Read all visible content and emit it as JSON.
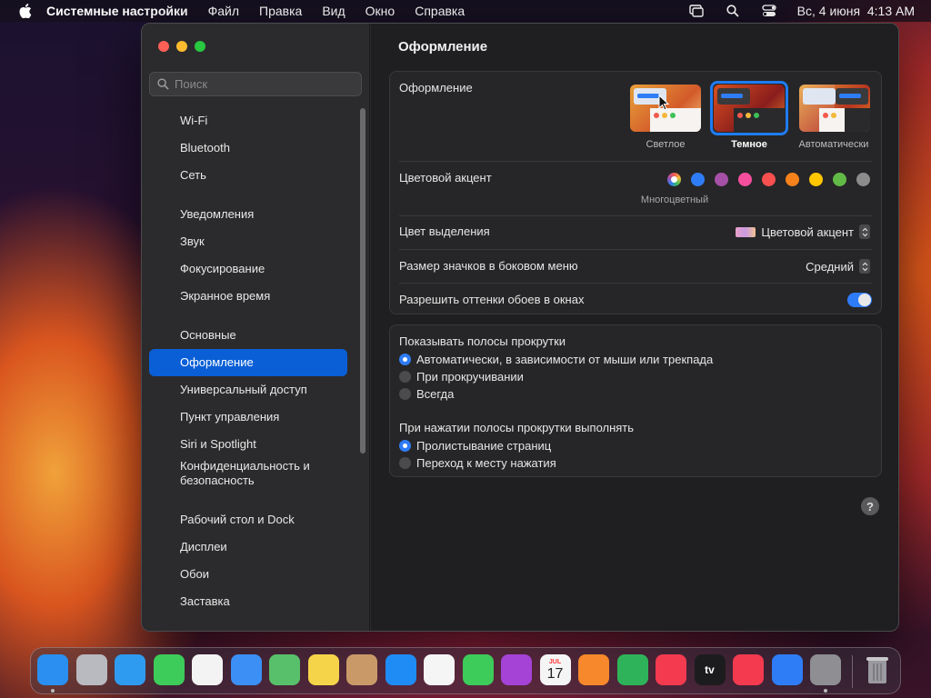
{
  "menubar": {
    "app": "Системные настройки",
    "items": [
      "Файл",
      "Правка",
      "Вид",
      "Окно",
      "Справка"
    ],
    "clock": "Вс, 4 июня  4:13 AM"
  },
  "sidebar": {
    "search_placeholder": "Поиск",
    "items": [
      {
        "label": "Wi-Fi",
        "icon": "wifi-icon",
        "color": "#2f7df6"
      },
      {
        "label": "Bluetooth",
        "icon": "bluetooth-icon",
        "color": "#2f7df6"
      },
      {
        "label": "Сеть",
        "icon": "globe-icon",
        "color": "#2f7df6"
      },
      {
        "label": "Уведомления",
        "icon": "bell-icon",
        "color": "#e5433a"
      },
      {
        "label": "Звук",
        "icon": "speaker-icon",
        "color": "#e5433a"
      },
      {
        "label": "Фокусирование",
        "icon": "moon-icon",
        "color": "#5b4fd6"
      },
      {
        "label": "Экранное время",
        "icon": "hourglass-icon",
        "color": "#5b4fd6"
      },
      {
        "label": "Основные",
        "icon": "gear-icon",
        "color": "#8e8e93"
      },
      {
        "label": "Оформление",
        "icon": "appearance-icon",
        "color": "#1c1c1e"
      },
      {
        "label": "Универсальный доступ",
        "icon": "accessibility-icon",
        "color": "#2f7df6"
      },
      {
        "label": "Пункт управления",
        "icon": "control-center-icon",
        "color": "#8e8e93"
      },
      {
        "label": "Siri и Spotlight",
        "icon": "siri-icon",
        "color": "#c04fd6"
      },
      {
        "label": "Конфиденциальность и безопасность",
        "icon": "hand-icon",
        "color": "#2f7df6"
      },
      {
        "label": "Рабочий стол и Dock",
        "icon": "dock-icon",
        "color": "#1c1c1e"
      },
      {
        "label": "Дисплеи",
        "icon": "display-icon",
        "color": "#2f7df6"
      },
      {
        "label": "Обои",
        "icon": "wallpaper-icon",
        "color": "#30b0e0"
      },
      {
        "label": "Заставка",
        "icon": "screensaver-icon",
        "color": "#30b0e0"
      }
    ],
    "active": "Оформление"
  },
  "main": {
    "title": "Оформление",
    "appearance": {
      "label": "Оформление",
      "options": [
        "Светлое",
        "Темное",
        "Автоматически"
      ],
      "selected": "Темное"
    },
    "accent": {
      "label": "Цветовой акцент",
      "caption": "Многоцветный",
      "colors": [
        "#2f7df6",
        "#a550a7",
        "#f74f9e",
        "#f7504f",
        "#f7821b",
        "#ffc700",
        "#62ba46",
        "#8c8c8c"
      ]
    },
    "highlight": {
      "label": "Цвет выделения",
      "value": "Цветовой акцент"
    },
    "sidebar_icon_size": {
      "label": "Размер значков в боковом меню",
      "value": "Средний"
    },
    "wallpaper_tint": {
      "label": "Разрешить оттенки обоев в окнах",
      "on": true
    },
    "scrollbars": {
      "label": "Показывать полосы прокрутки",
      "options": [
        "Автоматически, в зависимости от мыши или трекпада",
        "При прокручивании",
        "Всегда"
      ],
      "selected": 0
    },
    "click_scrollbar": {
      "label": "При нажатии полосы прокрутки выполнять",
      "options": [
        "Пролистывание страниц",
        "Переход к месту нажатия"
      ],
      "selected": 0
    },
    "help": "?"
  },
  "dock": {
    "apps": [
      {
        "name": "finder-icon",
        "color": "#2a8ff0"
      },
      {
        "name": "launchpad-icon",
        "color": "#b9b9c0"
      },
      {
        "name": "safari-icon",
        "color": "#2f9bf0"
      },
      {
        "name": "messages-icon",
        "color": "#3dcb5a"
      },
      {
        "name": "photos-icon",
        "color": "#f3f3f3"
      },
      {
        "name": "mail-icon",
        "color": "#3b8ff5"
      },
      {
        "name": "maps-icon",
        "color": "#58c06a"
      },
      {
        "name": "notes-icon",
        "color": "#f6d44a"
      },
      {
        "name": "contacts-icon",
        "color": "#c99a68"
      },
      {
        "name": "app-store-icon",
        "color": "#1f8cf5"
      },
      {
        "name": "reminders-icon",
        "color": "#f5f5f5"
      },
      {
        "name": "facetime-icon",
        "color": "#3dcb5a"
      },
      {
        "name": "podcasts-icon",
        "color": "#a443d6"
      },
      {
        "name": "calendar-icon",
        "color": "#f5f5f5"
      },
      {
        "name": "books-icon",
        "color": "#f7882b"
      },
      {
        "name": "find-my-icon",
        "color": "#2fb35a"
      },
      {
        "name": "music-icon",
        "color": "#f33a4f"
      },
      {
        "name": "tv-icon",
        "color": "#1c1c1e"
      },
      {
        "name": "news-icon",
        "color": "#f33a4f"
      },
      {
        "name": "keynote-icon",
        "color": "#2f7df6"
      },
      {
        "name": "system-settings-icon",
        "color": "#8e8e93"
      }
    ],
    "calendar_month": "JUL",
    "calendar_day": "17",
    "tv_label": "tv",
    "trash": "trash-icon"
  }
}
